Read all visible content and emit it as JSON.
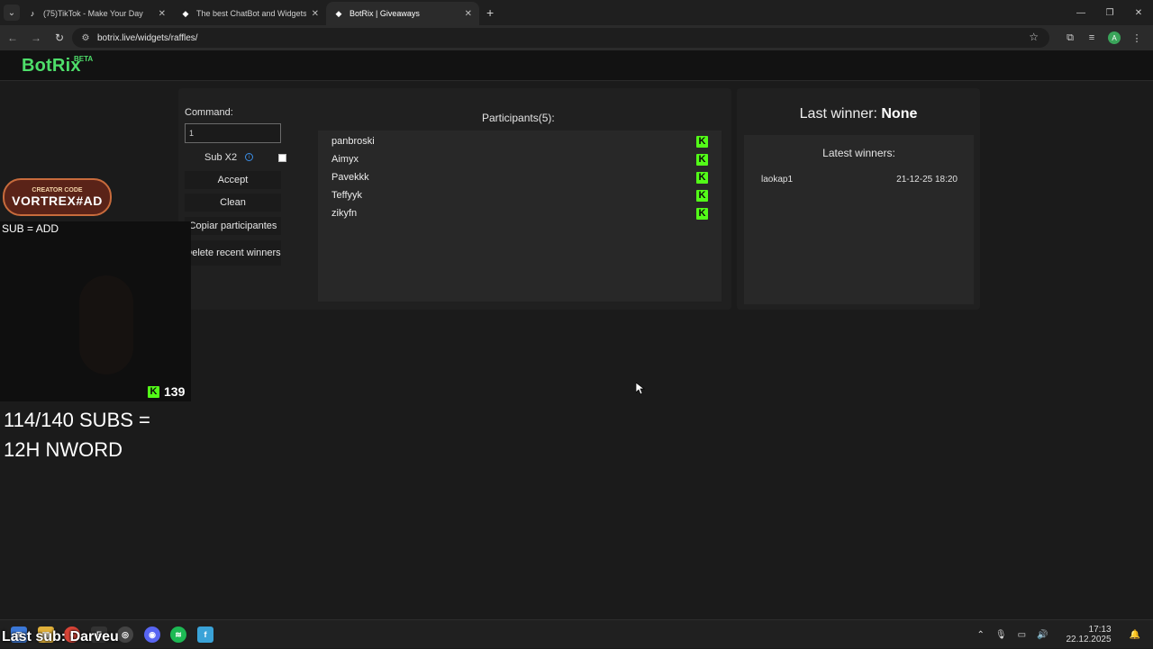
{
  "browser": {
    "tabs": [
      {
        "title": "(75)TikTok - Make Your Day",
        "icon": "tiktok-icon",
        "active": false
      },
      {
        "title": "The best ChatBot and Widgets",
        "icon": "botrix-icon",
        "active": false
      },
      {
        "title": "BotRix | Giveaways",
        "icon": "botrix-icon",
        "active": true
      }
    ],
    "url": "botrix.live/widgets/raffles/",
    "profile_initial": "A"
  },
  "header": {
    "logo": "BotRix",
    "beta": "BETA"
  },
  "controls": {
    "command_label": "Command:",
    "command_value": "1",
    "subx2_label": "Sub X2",
    "accept": "Accept",
    "clean": "Clean",
    "copy": "Copiar participantes",
    "delete": "Delete recent winners"
  },
  "participants": {
    "title": "Participants(5):",
    "platform_icon": "K",
    "items": [
      "panbroski",
      "Aimyx",
      "Pavekkk",
      "Teffyyk",
      "zikyfn"
    ]
  },
  "winners": {
    "last_winner_label": "Last winner:",
    "last_winner_value": "None",
    "latest_title": "Latest winners:",
    "latest": [
      {
        "name": "laokap1",
        "date": "21-12-25 18:20"
      }
    ]
  },
  "overlay": {
    "creator_code_top": "CREATOR CODE",
    "creator_code_main": "VORTREX#AD",
    "sub_add": "SUB = ADD",
    "kick_icon": "K",
    "kick_count": "139",
    "subs_goal_line1": "114/140 SUBS =",
    "subs_goal_line2": "12H NWORD",
    "last_sub": "Last sub: Darveu"
  },
  "taskbar": {
    "time": "17:13",
    "date": "22.12.2025"
  },
  "colors": {
    "kick_green": "#53fc18",
    "brand_green": "#4ede6a",
    "background": "#1b1b1b"
  }
}
